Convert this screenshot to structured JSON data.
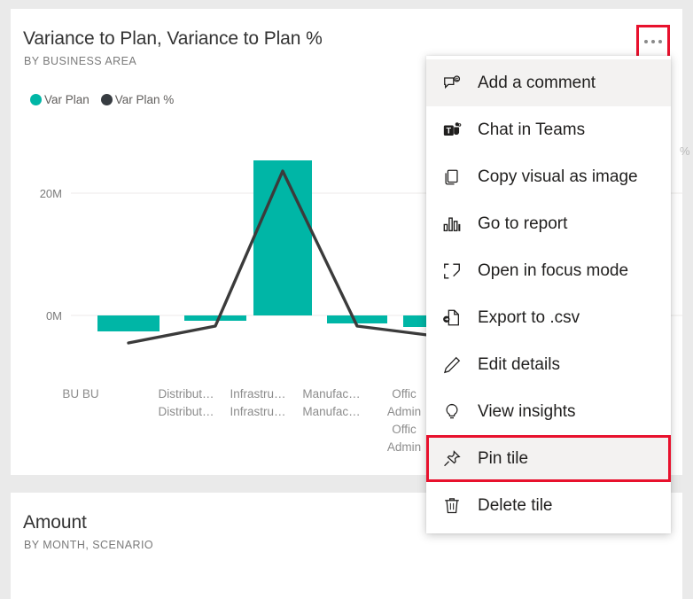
{
  "tiles": [
    {
      "id": "variance",
      "title": "Variance to Plan, Variance to Plan %",
      "subtitle": "BY BUSINESS AREA"
    },
    {
      "id": "amount",
      "title": "Amount",
      "subtitle": "BY MONTH, SCENARIO"
    }
  ],
  "more_options": {
    "label": "More options",
    "highlight_color": "#e8112d"
  },
  "right_axis_clipped_tick": "%",
  "context_menu": {
    "items": [
      {
        "label": "Add a comment",
        "icon": "comment-icon",
        "state": "hovered"
      },
      {
        "label": "Chat in Teams",
        "icon": "teams-icon",
        "state": "normal"
      },
      {
        "label": "Copy visual as image",
        "icon": "copy-icon",
        "state": "normal"
      },
      {
        "label": "Go to report",
        "icon": "bar-chart-icon",
        "state": "normal"
      },
      {
        "label": "Open in focus mode",
        "icon": "focus-mode-icon",
        "state": "normal"
      },
      {
        "label": "Export to .csv",
        "icon": "export-file-icon",
        "state": "normal"
      },
      {
        "label": "Edit details",
        "icon": "pencil-icon",
        "state": "normal"
      },
      {
        "label": "View insights",
        "icon": "lightbulb-icon",
        "state": "normal"
      },
      {
        "label": "Pin tile",
        "icon": "pin-icon",
        "state": "highlighted"
      },
      {
        "label": "Delete tile",
        "icon": "trash-icon",
        "state": "normal"
      }
    ]
  },
  "chart_data": {
    "type": "bar",
    "title": "Variance to Plan, Variance to Plan %",
    "subtitle": "BY BUSINESS AREA",
    "xlabel": "",
    "ylabel": "",
    "grid": true,
    "legend_position": "top-left",
    "colors": {
      "bars": "#00b6a6",
      "line": "#3b3b3b"
    },
    "categories": [
      "BU BU",
      "Distribut… Distribut…",
      "Infrastru… Infrastru…",
      "Manufac… Manufac…",
      "Offic Admin Offic Admin"
    ],
    "yticks": [
      "0M",
      "20M"
    ],
    "ylim": [
      -5000000,
      25000000
    ],
    "series": [
      {
        "name": "Var Plan",
        "type": "bar",
        "values": [
          -2600000,
          -400000,
          22500000,
          -900000,
          -1400000
        ]
      },
      {
        "name": "Var Plan %",
        "type": "line",
        "values": [
          -4.5,
          -1.4,
          21.5,
          -1.0,
          -2.6
        ]
      }
    ]
  }
}
